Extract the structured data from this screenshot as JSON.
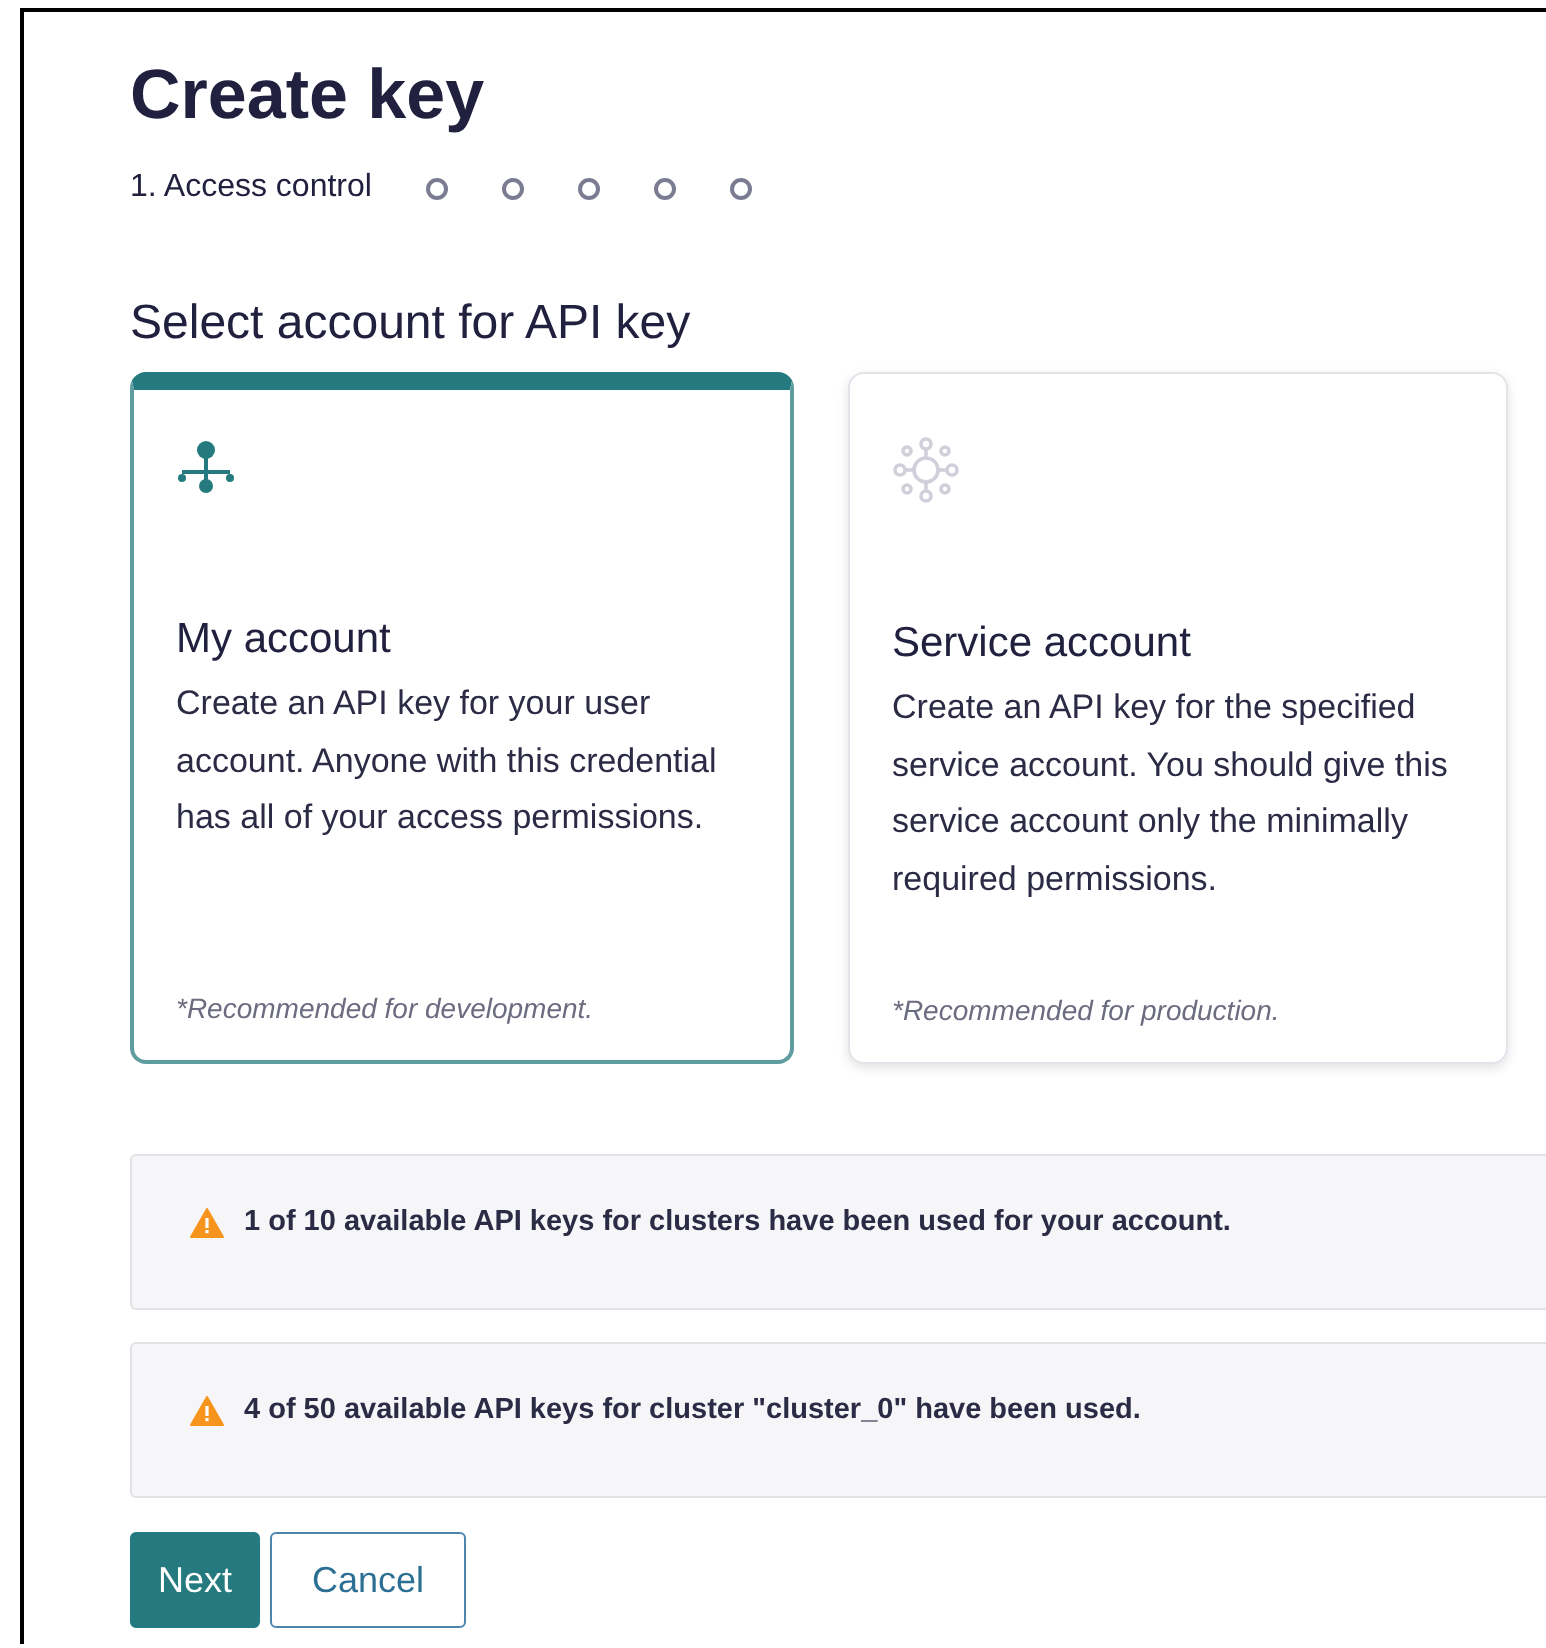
{
  "title": "Create key",
  "steps": [
    {
      "label": "1. Access control",
      "selected": true
    },
    {
      "selected": false
    },
    {
      "selected": false
    },
    {
      "selected": false
    },
    {
      "selected": false
    },
    {
      "selected": false
    }
  ],
  "section_title": "Select account for API key",
  "accounts": [
    {
      "kind": "user",
      "title": "My account",
      "description": "Create an API key for your user account. Anyone with this credential has all of your access permissions.",
      "note": "*Recommended for development.",
      "selected": true
    },
    {
      "kind": "service",
      "title": "Service account",
      "description": "Create an API key for the specified service account. You should give this service account only the minimally required permissions.",
      "note": "*Recommended for production.",
      "selected": false
    }
  ],
  "alerts": [
    "1 of 10 available API keys for clusters have been used for your account.",
    "4 of 50 available API keys for cluster \"cluster_0\" have been used."
  ],
  "buttons": [
    {
      "kind": "primary",
      "label": "Next"
    },
    {
      "kind": "secondary",
      "label": "Cancel"
    }
  ]
}
